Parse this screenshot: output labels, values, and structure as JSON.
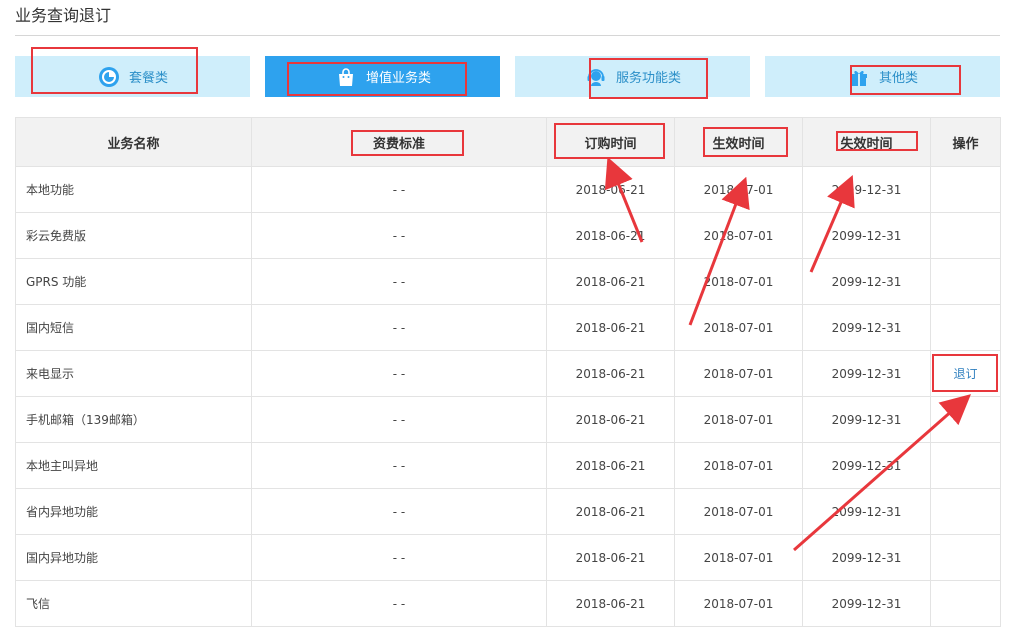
{
  "page": {
    "title": "业务查询退订"
  },
  "tabs": [
    {
      "label": "套餐类",
      "icon": "pie-chart-icon",
      "active": false
    },
    {
      "label": "增值业务类",
      "icon": "shopping-bag-icon",
      "active": true
    },
    {
      "label": "服务功能类",
      "icon": "headset-agent-icon",
      "active": false
    },
    {
      "label": "其他类",
      "icon": "gift-box-icon",
      "active": false
    }
  ],
  "table": {
    "headers": [
      "业务名称",
      "资费标准",
      "订购时间",
      "生效时间",
      "失效时间",
      "操作"
    ],
    "rows": [
      {
        "name": "本地功能",
        "fee": "- -",
        "order": "2018-06-21",
        "effective": "2018-07-01",
        "expire": "2099-12-31",
        "action": ""
      },
      {
        "name": "彩云免费版",
        "fee": "- -",
        "order": "2018-06-21",
        "effective": "2018-07-01",
        "expire": "2099-12-31",
        "action": ""
      },
      {
        "name": "GPRS 功能",
        "fee": "- -",
        "order": "2018-06-21",
        "effective": "2018-07-01",
        "expire": "2099-12-31",
        "action": ""
      },
      {
        "name": "国内短信",
        "fee": "- -",
        "order": "2018-06-21",
        "effective": "2018-07-01",
        "expire": "2099-12-31",
        "action": ""
      },
      {
        "name": "来电显示",
        "fee": "- -",
        "order": "2018-06-21",
        "effective": "2018-07-01",
        "expire": "2099-12-31",
        "action": "退订"
      },
      {
        "name": "手机邮箱（139邮箱）",
        "fee": "- -",
        "order": "2018-06-21",
        "effective": "2018-07-01",
        "expire": "2099-12-31",
        "action": ""
      },
      {
        "name": "本地主叫异地",
        "fee": "- -",
        "order": "2018-06-21",
        "effective": "2018-07-01",
        "expire": "2099-12-31",
        "action": ""
      },
      {
        "name": "省内异地功能",
        "fee": "- -",
        "order": "2018-06-21",
        "effective": "2018-07-01",
        "expire": "2099-12-31",
        "action": ""
      },
      {
        "name": "国内异地功能",
        "fee": "- -",
        "order": "2018-06-21",
        "effective": "2018-07-01",
        "expire": "2099-12-31",
        "action": ""
      },
      {
        "name": "飞信",
        "fee": "- -",
        "order": "2018-06-21",
        "effective": "2018-07-01",
        "expire": "2099-12-31",
        "action": ""
      }
    ]
  },
  "colors": {
    "tab_inactive_bg": "#cfeefb",
    "tab_active_bg": "#2ea2ee",
    "tab_text": "#2b8fc8",
    "link": "#2f7fbf",
    "annotation": "#e8373c"
  }
}
